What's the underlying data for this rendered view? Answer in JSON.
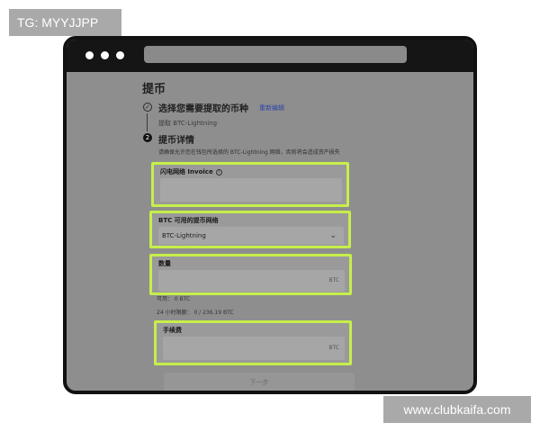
{
  "overlay": {
    "tg_label": "TG: MYYJJPP",
    "watermark": "www.clubkaifa.com"
  },
  "page": {
    "title": "提币",
    "step1": {
      "title": "选择您需要提取的币种",
      "link": "重新编辑",
      "summary": "提取 BTC-Lightning"
    },
    "step2": {
      "number": "2",
      "title": "提币详情",
      "description": "请确保允许您在钱包所选择的 BTC-Lightning 网络，否则将会造成资产损失"
    }
  },
  "form": {
    "invoice": {
      "label": "闪电网络 Invoice",
      "info_icon": "info-icon",
      "value": ""
    },
    "network": {
      "label": "BTC 可用的提币网络",
      "selected": "BTC-Lightning"
    },
    "amount": {
      "label": "数量",
      "unit": "BTC",
      "value": ""
    },
    "available": "可用：  0 BTC",
    "limit_24h": "24 小时限额：  0 / 236.19 BTC",
    "fee": {
      "label": "手续费",
      "unit": "BTC",
      "value": ""
    },
    "next_button": "下一步"
  },
  "colors": {
    "highlight": "#c6ef4a",
    "link": "#2b44a8"
  }
}
